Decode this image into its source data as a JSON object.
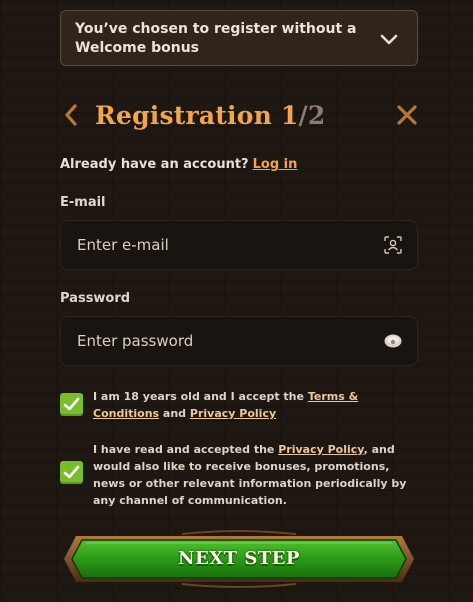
{
  "bonus": {
    "text": "You’ve chosen to register without a Welcome bonus",
    "icon": "chevron-down-icon"
  },
  "header": {
    "title": "Registration",
    "step_current": "1",
    "step_sep": "/",
    "step_total": "2"
  },
  "account": {
    "prompt": "Already have an account?",
    "login_link": "Log in"
  },
  "email": {
    "label": "E-mail",
    "placeholder": "Enter e-mail",
    "icon": "contact-icon"
  },
  "password": {
    "label": "Password",
    "placeholder": "Enter password",
    "icon": "eye-icon"
  },
  "consents": [
    {
      "checked": true,
      "text_a": "I am 18 years old and I accept the",
      "link1": "Terms & Conditions",
      "text_b": "and",
      "link2": "Privacy Policy"
    },
    {
      "checked": true,
      "text_a": "I have read and accepted the",
      "link1": "Privacy Policy",
      "text_b": ", and would also like to receive bonuses, promotions, news or other relevant information periodically by any channel of communication."
    }
  ],
  "next_button": {
    "label": "NEXT STEP"
  },
  "colors": {
    "accent": "#f0a64d",
    "check": "#78bd2c",
    "button": "#2e9a1c",
    "background": "#1e1712"
  }
}
